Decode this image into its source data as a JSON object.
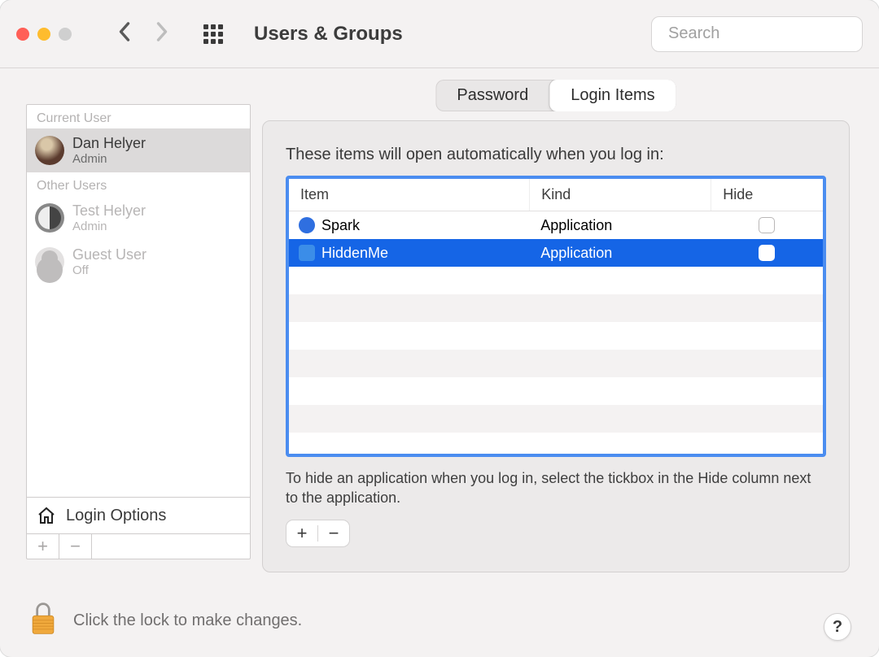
{
  "window": {
    "title": "Users & Groups"
  },
  "search": {
    "placeholder": "Search"
  },
  "sidebar": {
    "current_label": "Current User",
    "other_label": "Other Users",
    "current_user": {
      "name": "Dan Helyer",
      "role": "Admin"
    },
    "other_users": [
      {
        "name": "Test Helyer",
        "role": "Admin"
      },
      {
        "name": "Guest User",
        "role": "Off"
      }
    ],
    "login_options_label": "Login Options"
  },
  "tabs": {
    "password": "Password",
    "login_items": "Login Items"
  },
  "panel": {
    "subtitle": "These items will open automatically when you log in:",
    "columns": {
      "item": "Item",
      "kind": "Kind",
      "hide": "Hide"
    },
    "rows": [
      {
        "name": "Spark",
        "kind": "Application",
        "selected": false,
        "icon": "circle"
      },
      {
        "name": "HiddenMe",
        "kind": "Application",
        "selected": true,
        "icon": "square"
      }
    ],
    "note": "To hide an application when you log in, select the tickbox in the Hide column next to the application.",
    "plus": "+",
    "minus": "−"
  },
  "footer": {
    "lock_text": "Click the lock to make changes.",
    "help": "?"
  }
}
